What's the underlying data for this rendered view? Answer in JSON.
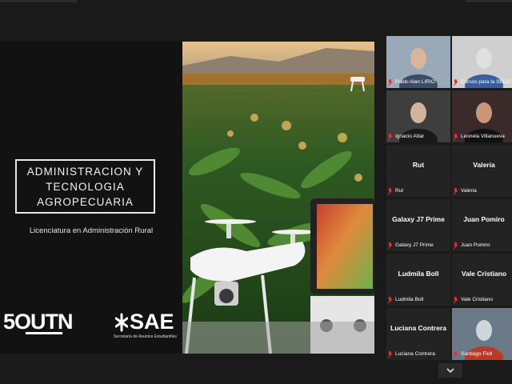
{
  "slide": {
    "title": "ADMINISTRACION Y\nTECNOLOGIA\nAGROPECUARIA",
    "subtitle": "Licenciatura en Administración Rural",
    "logo_utn": "5OUTN",
    "logo_sae": "SAE",
    "logo_sae_sub": "Secretaría de Asuntos Estudiantiles"
  },
  "participants": [
    {
      "name": "Pablo Alan LIRIO",
      "display": "",
      "video": true,
      "active": true
    },
    {
      "name": "Cursos para la SECU",
      "display": "",
      "video": true
    },
    {
      "name": "Ignacio Attar",
      "display": "",
      "video": true
    },
    {
      "name": "Leonela Villanueva",
      "display": "",
      "video": true
    },
    {
      "name": "Rut",
      "display": "Rut"
    },
    {
      "name": "Valeria",
      "display": "Valeria"
    },
    {
      "name": "Galaxy J7 Prime",
      "display": "Galaxy J7 Prime"
    },
    {
      "name": "Juan Pomiro",
      "display": "Juan Pomiro"
    },
    {
      "name": "Ludmila Boll",
      "display": "Ludmila Boll"
    },
    {
      "name": "Vale Cristiano",
      "display": "Vale Cristiano"
    },
    {
      "name": "Luciana Contrera",
      "display": "Luciana Contrera"
    },
    {
      "name": "Santiago Fioli",
      "display": "",
      "video": true
    }
  ],
  "icons": {
    "scroll": "chevron-down-icon",
    "mic": "mic-muted-icon"
  },
  "colors": {
    "active_speaker": "#c7e33c",
    "muted": "#e0303a",
    "tile_bg": "#232323"
  }
}
